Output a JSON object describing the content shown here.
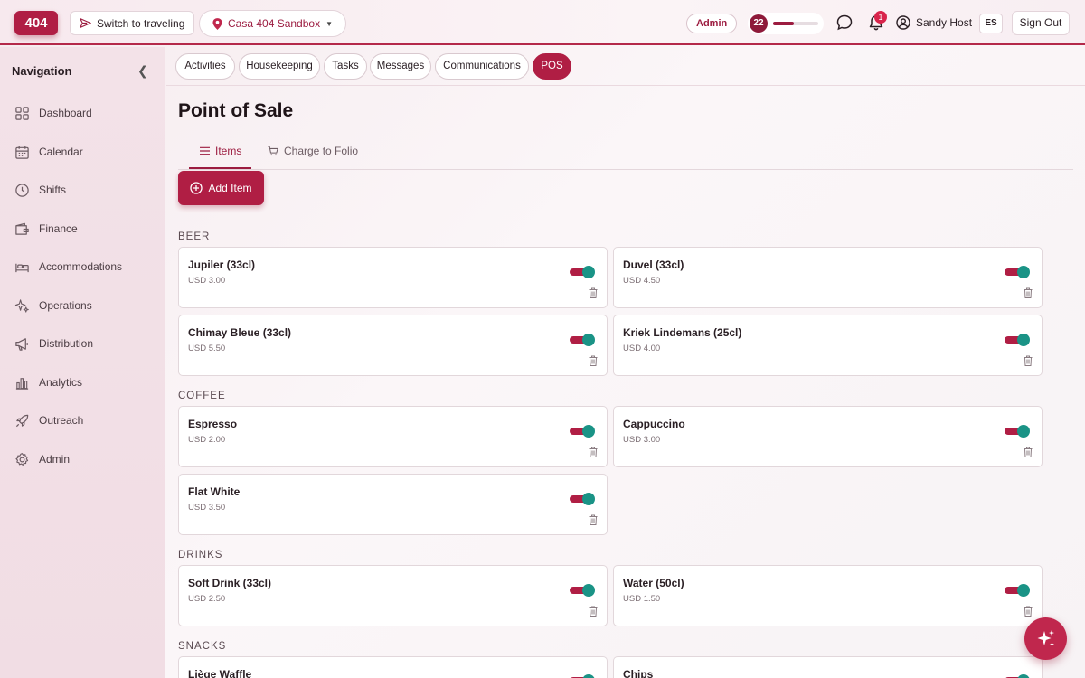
{
  "header": {
    "logo": "404",
    "switch_label": "Switch to traveling",
    "property_label": "Casa 404 Sandbox",
    "role_badge": "Admin",
    "level": "22",
    "level_progress": 0.45,
    "notifications": "1",
    "user_name": "Sandy Host",
    "language": "ES",
    "sign_out": "Sign Out"
  },
  "sidebar": {
    "title": "Navigation",
    "items": [
      {
        "label": "Dashboard",
        "icon": "grid-icon"
      },
      {
        "label": "Calendar",
        "icon": "calendar-icon"
      },
      {
        "label": "Shifts",
        "icon": "clock-icon"
      },
      {
        "label": "Finance",
        "icon": "wallet-icon"
      },
      {
        "label": "Accommodations",
        "icon": "bed-icon"
      },
      {
        "label": "Operations",
        "icon": "sparkles-icon"
      },
      {
        "label": "Distribution",
        "icon": "megaphone-icon"
      },
      {
        "label": "Analytics",
        "icon": "bar-chart-icon"
      },
      {
        "label": "Outreach",
        "icon": "rocket-icon"
      },
      {
        "label": "Admin",
        "icon": "gear-icon"
      }
    ]
  },
  "tabs": [
    "Activities",
    "Housekeeping",
    "Tasks",
    "Messages",
    "Communications",
    "POS"
  ],
  "active_tab": "POS",
  "page": {
    "title": "Point of Sale",
    "subtabs": [
      "Items",
      "Charge to Folio"
    ],
    "add_button": "Add Item"
  },
  "sections": [
    {
      "name": "BEER",
      "items": [
        {
          "name": "Jupiler (33cl)",
          "price": "USD 3.00"
        },
        {
          "name": "Duvel (33cl)",
          "price": "USD 4.50"
        },
        {
          "name": "Chimay Bleue (33cl)",
          "price": "USD 5.50"
        },
        {
          "name": "Kriek Lindemans (25cl)",
          "price": "USD 4.00"
        }
      ]
    },
    {
      "name": "COFFEE",
      "items": [
        {
          "name": "Espresso",
          "price": "USD 2.00"
        },
        {
          "name": "Cappuccino",
          "price": "USD 3.00"
        },
        {
          "name": "Flat White",
          "price": "USD 3.50"
        }
      ]
    },
    {
      "name": "DRINKS",
      "items": [
        {
          "name": "Soft Drink (33cl)",
          "price": "USD 2.50"
        },
        {
          "name": "Water (50cl)",
          "price": "USD 1.50"
        }
      ]
    },
    {
      "name": "SNACKS",
      "items": [
        {
          "name": "Liège Waffle",
          "price": ""
        },
        {
          "name": "Chips",
          "price": ""
        }
      ]
    }
  ],
  "colors": {
    "accent": "#b01e44",
    "toggle_on": "#1a9386"
  }
}
